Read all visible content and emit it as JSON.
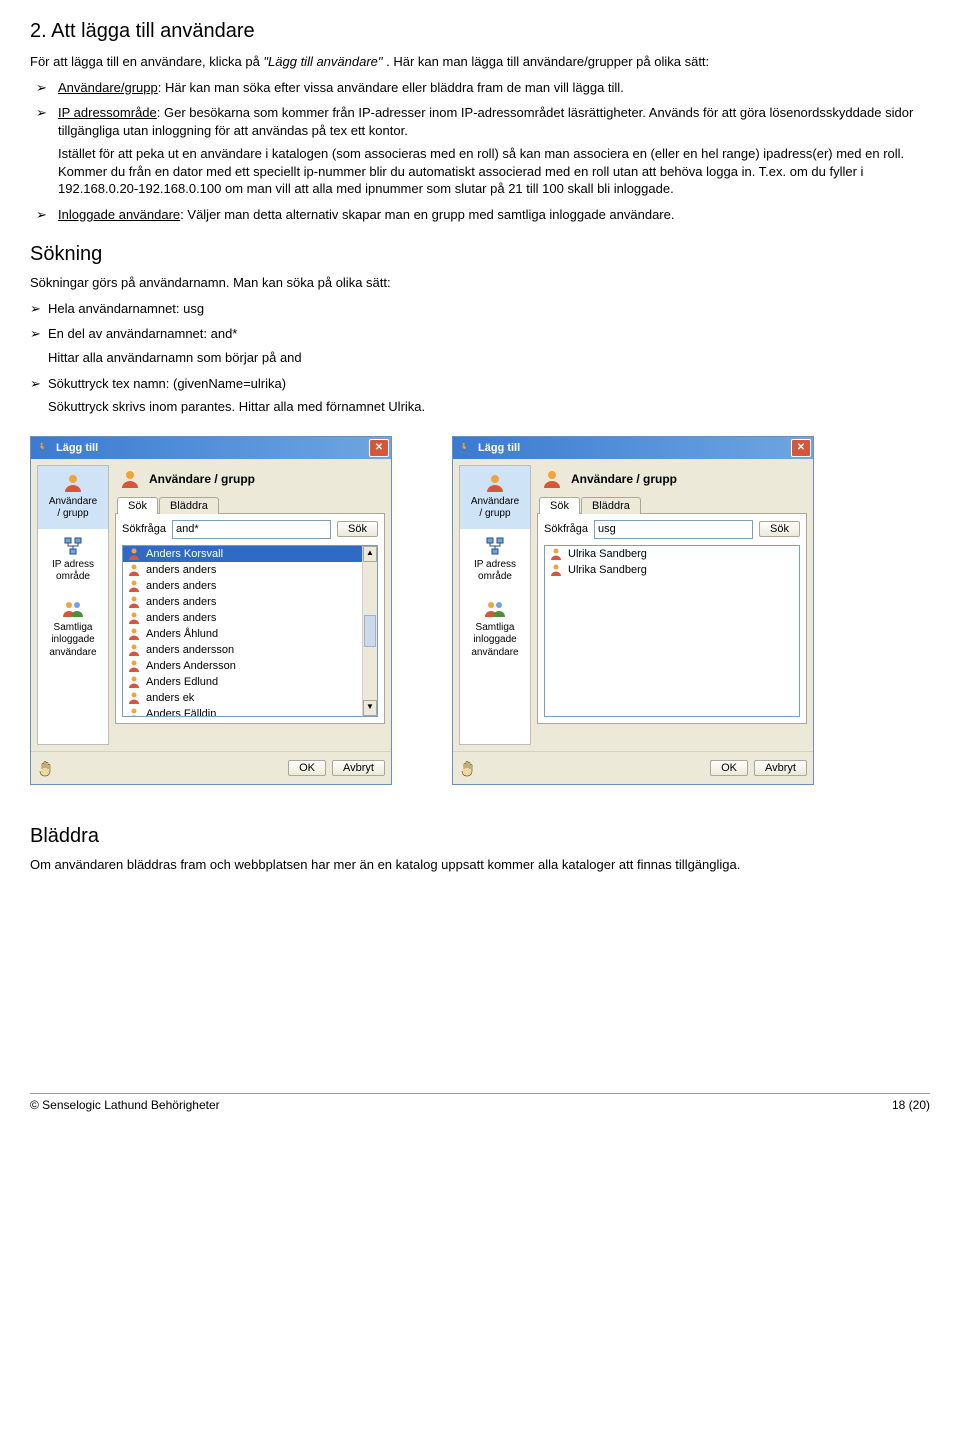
{
  "h1": "2. Att lägga till användare",
  "intro_before": "För att lägga till en användare, klicka på ",
  "intro_italic": "\"Lägg till användare\"",
  "intro_after": ". Här kan man lägga till användare/grupper på olika sätt:",
  "bullets1": {
    "b1_label": "Användare/grupp",
    "b1_rest": ": Här kan man söka efter vissa användare eller bläddra fram de man vill lägga till.",
    "b2_label": "IP adressområde",
    "b2_rest": ": Ger besökarna som kommer från IP-adresser inom IP-adressområdet läsrättigheter. Används för att göra lösenordsskyddade sidor tillgängliga utan inloggning för att användas på tex ett kontor.",
    "b2_para": "Istället för att peka ut en användare i katalogen (som associeras med en roll) så kan man associera en (eller en hel range) ipadress(er) med en roll. Kommer du från en dator med ett speciellt ip-nummer blir du automatiskt associerad med en roll utan att behöva logga in. T.ex. om du fyller i 192.168.0.20-192.168.0.100 om man vill att alla med ipnummer som slutar på 21 till 100 skall bli inloggade.",
    "b3_label": "Inloggade användare",
    "b3_rest": ": Väljer man detta alternativ skapar man en grupp med samtliga inloggade användare."
  },
  "h2_search": "Sökning",
  "p_search_intro": "Sökningar görs på användarnamn. Man kan söka på olika sätt:",
  "search_list": {
    "i1": "Hela användarnamnet: usg",
    "i2": "En del av användarnamnet: and*",
    "i2_sub": "Hittar alla användarnamn som börjar på and",
    "i3": "Sökuttryck tex namn: (givenName=ulrika)",
    "i3_sub": "Sökuttryck skrivs inom parantes. Hittar alla med förnamnet Ulrika."
  },
  "dialog": {
    "title": "Lägg till",
    "panel_header": "Användare / grupp",
    "tab_search": "Sök",
    "tab_browse": "Bläddra",
    "search_label": "Sökfråga",
    "search_btn": "Sök",
    "ok": "OK",
    "cancel": "Avbryt",
    "sidebar": {
      "i1a": "Användare",
      "i1b": "/ grupp",
      "i2a": "IP adress",
      "i2b": "område",
      "i3a": "Samtliga",
      "i3b": "inloggade",
      "i3c": "användare"
    },
    "q_left": "and*",
    "q_right": "usg",
    "results_left": [
      "Anders Korsvall",
      "anders anders",
      "anders anders",
      "anders anders",
      "anders anders",
      "Anders Åhlund",
      "anders andersson",
      "Anders Andersson",
      "Anders Edlund",
      "anders ek",
      "Anders Fälldin"
    ],
    "results_right": [
      "Ulrika Sandberg",
      "Ulrika Sandberg"
    ]
  },
  "h2_browse": "Bläddra",
  "p_browse": "Om användaren bläddras fram och webbplatsen har mer än en katalog uppsatt kommer alla kataloger att finnas tillgängliga.",
  "footer_left": "© Senselogic Lathund Behörigheter",
  "footer_right": "18 (20)"
}
